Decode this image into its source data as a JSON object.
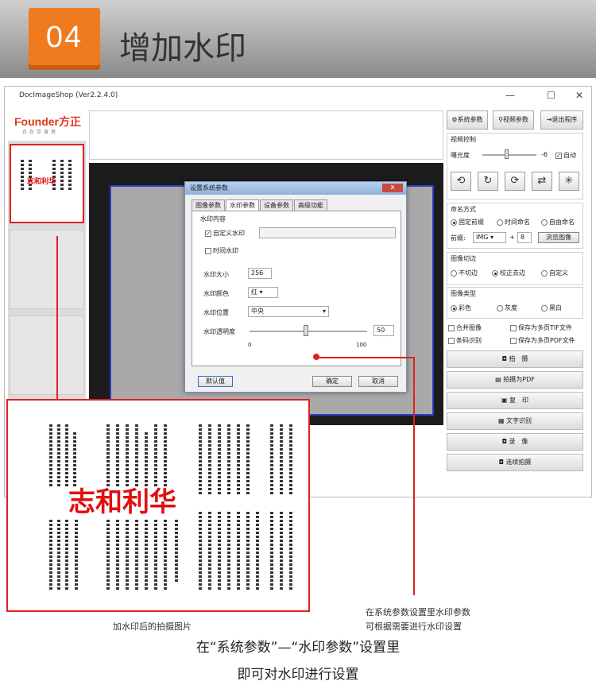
{
  "banner": {
    "num": "04",
    "title": "增加水印"
  },
  "window": {
    "title": "DocImageShop (Ver2.2.4.0)",
    "min": "—",
    "max": "☐",
    "close": "✕"
  },
  "logo": {
    "text": "Founder方正",
    "sub": "正在存身良"
  },
  "thumb_watermark": "志和利华",
  "right": {
    "btn_sys": "系统参数",
    "btn_video": "视频参数",
    "btn_exit": "退出程序",
    "video_ctrl": "视频控制",
    "exposure": "曝光度",
    "exposure_val": "-6",
    "auto": "自动",
    "naming": "命名方式",
    "naming_opts": [
      "固定前缀",
      "时间命名",
      "自由命名"
    ],
    "prefix_label": "前缀:",
    "prefix_val": "IMG",
    "plus": "+",
    "num": "8",
    "browse": "浏览图像",
    "crop": "图像切边",
    "crop_opts": [
      "不切边",
      "校正去边",
      "自定义"
    ],
    "type": "图像类型",
    "type_opts": [
      "彩色",
      "灰度",
      "黑白"
    ],
    "merge": "合并图像",
    "tif": "保存为多页TIF文件",
    "barcode": "条码识别",
    "pdf": "保存为多页PDF文件",
    "actions": [
      "拍　摄",
      "拍摄为PDF",
      "复　印",
      "文字识别",
      "录　像",
      "连续拍摄"
    ]
  },
  "dialog": {
    "title": "设置系统参数",
    "close": "x",
    "tabs": [
      "图像参数",
      "水印参数",
      "设备参数",
      "高级功能"
    ],
    "content": "水印内容",
    "custom": "自定义水印",
    "time": "时间水印",
    "size_label": "水印大小",
    "size_val": "256",
    "color_label": "水印颜色",
    "color_val": "红",
    "pos_label": "水印位置",
    "pos_val": "中央",
    "alpha_label": "水印透明度",
    "alpha_val": "50",
    "alpha_min": "0",
    "alpha_max": "100",
    "default": "默认值",
    "ok": "确定",
    "cancel": "取消"
  },
  "zoom": {
    "watermark": "志和利华"
  },
  "captions": {
    "left": "加水印后的拍摄图片",
    "right1": "在系统参数设置里水印参数",
    "right2": "可根据需要进行水印设置"
  },
  "footer": {
    "line1": "在“系统参数”—“水印参数”设置里",
    "line2": "即可对水印进行设置"
  },
  "colors": {
    "accent": "#f07a1e",
    "highlight": "#e02020"
  }
}
